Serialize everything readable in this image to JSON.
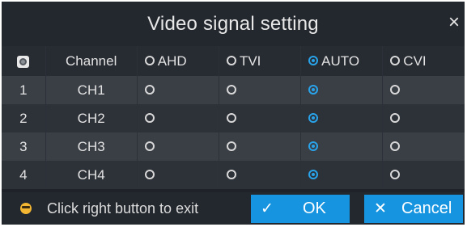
{
  "dialog": {
    "title": "Video signal setting",
    "close_glyph": "×"
  },
  "table": {
    "header": {
      "select_icon": "select-all-icon",
      "channel": "Channel",
      "options": [
        "AHD",
        "TVI",
        "AUTO",
        "CVI"
      ],
      "selected_option": "AUTO"
    },
    "rows": [
      {
        "index": "1",
        "channel": "CH1",
        "selected": "AUTO"
      },
      {
        "index": "2",
        "channel": "CH2",
        "selected": "AUTO"
      },
      {
        "index": "3",
        "channel": "CH3",
        "selected": "AUTO"
      },
      {
        "index": "4",
        "channel": "CH4",
        "selected": "AUTO"
      }
    ]
  },
  "footer": {
    "hint_icon": "smiley-icon",
    "hint": "Click right button to exit",
    "ok_label": "OK",
    "ok_icon_glyph": "✓",
    "cancel_label": "Cancel",
    "cancel_icon_glyph": "✕"
  },
  "colors": {
    "accent": "#1794e0",
    "radio_selected": "#29a3ea",
    "background": "#1f2329"
  }
}
